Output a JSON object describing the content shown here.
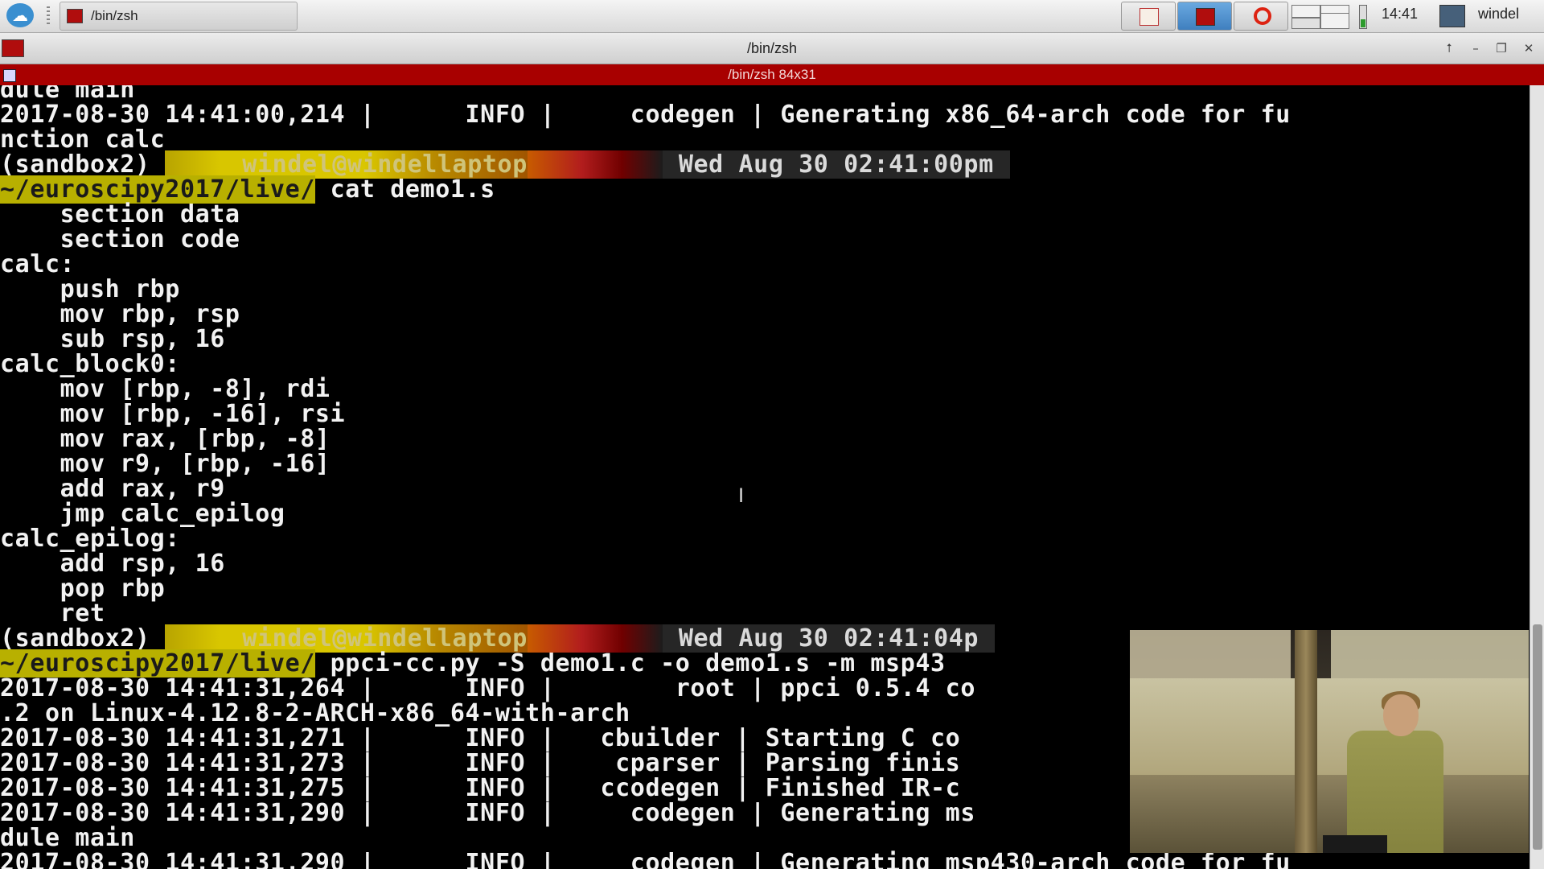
{
  "taskbar": {
    "task_label": "/bin/zsh",
    "clock": "14:41",
    "user": "windel"
  },
  "window": {
    "title": "/bin/zsh",
    "tab_title": "/bin/zsh 84x31"
  },
  "terminal": {
    "lines": [
      {
        "text": "dule main",
        "kind": "plain"
      },
      {
        "text": "2017-08-30 14:41:00,214 |      INFO |     codegen | Generating x86_64-arch code for fu",
        "kind": "plain"
      },
      {
        "text": "nction calc",
        "kind": "plain"
      },
      {
        "kind": "prompt1",
        "env": "(sandbox2)",
        "user": "windel@windellaptop",
        "date": "Wed Aug 30 02:41:00pm"
      },
      {
        "kind": "prompt2",
        "cwd": "~/euroscipy2017/live/",
        "cmd": " cat demo1.s"
      },
      {
        "text": "    section data",
        "kind": "plain"
      },
      {
        "text": "    section code",
        "kind": "plain"
      },
      {
        "text": "calc:",
        "kind": "plain"
      },
      {
        "text": "    push rbp",
        "kind": "plain"
      },
      {
        "text": "    mov rbp, rsp",
        "kind": "plain"
      },
      {
        "text": "    sub rsp, 16",
        "kind": "plain"
      },
      {
        "text": "calc_block0:",
        "kind": "plain"
      },
      {
        "text": "    mov [rbp, -8], rdi",
        "kind": "plain"
      },
      {
        "text": "    mov [rbp, -16], rsi",
        "kind": "plain"
      },
      {
        "text": "    mov rax, [rbp, -8]",
        "kind": "plain"
      },
      {
        "text": "    mov r9, [rbp, -16]",
        "kind": "plain"
      },
      {
        "text": "    add rax, r9",
        "kind": "plain"
      },
      {
        "text": "    jmp calc_epilog",
        "kind": "plain"
      },
      {
        "text": "calc_epilog:",
        "kind": "plain"
      },
      {
        "text": "    add rsp, 16",
        "kind": "plain"
      },
      {
        "text": "    pop rbp",
        "kind": "plain"
      },
      {
        "text": "    ret",
        "kind": "plain"
      },
      {
        "kind": "prompt1",
        "env": "(sandbox2)",
        "user": "windel@windellaptop",
        "date": "Wed Aug 30 02:41:04p"
      },
      {
        "kind": "prompt2",
        "cwd": "~/euroscipy2017/live/",
        "cmd": " ppci-cc.py -S demo1.c -o demo1.s -m msp43"
      },
      {
        "text": "2017-08-30 14:41:31,264 |      INFO |        root | ppci 0.5.4 co",
        "kind": "plain"
      },
      {
        "text": ".2 on Linux-4.12.8-2-ARCH-x86_64-with-arch",
        "kind": "plain"
      },
      {
        "text": "2017-08-30 14:41:31,271 |      INFO |   cbuilder | Starting C co",
        "kind": "plain"
      },
      {
        "text": "2017-08-30 14:41:31,273 |      INFO |    cparser | Parsing finis",
        "kind": "plain"
      },
      {
        "text": "2017-08-30 14:41:31,275 |      INFO |   ccodegen | Finished IR-c",
        "kind": "plain"
      },
      {
        "text": "2017-08-30 14:41:31,290 |      INFO |     codegen | Generating ms",
        "kind": "plain"
      },
      {
        "text": "dule main",
        "kind": "plain"
      },
      {
        "text": "2017-08-30 14:41:31,290 |      INFO |     codegen | Generating msp430-arch code for fu",
        "kind": "plain"
      }
    ]
  }
}
